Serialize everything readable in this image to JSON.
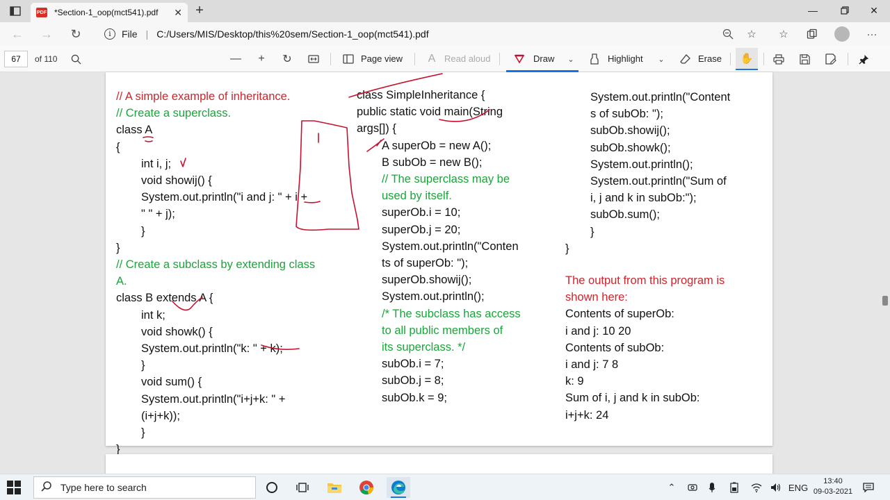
{
  "tab": {
    "title": "*Section-1_oop(mct541).pdf",
    "badge": "PDF"
  },
  "address": {
    "file_label": "File",
    "url": "C:/Users/MIS/Desktop/this%20sem/Section-1_oop(mct541).pdf"
  },
  "pdf_toolbar": {
    "page_current": "67",
    "page_total": "of 110",
    "page_view_label": "Page view",
    "read_aloud_label": "Read aloud",
    "draw_label": "Draw",
    "highlight_label": "Highlight",
    "erase_label": "Erase"
  },
  "document": {
    "col1": [
      {
        "text": "// A simple example of inheritance.",
        "color": "red",
        "indent": 0
      },
      {
        "text": "// Create a superclass.",
        "color": "green",
        "indent": 0
      },
      {
        "text": "class A",
        "color": "black",
        "indent": 0
      },
      {
        "text": "{",
        "color": "black",
        "indent": 0
      },
      {
        "text": "int i, j;",
        "color": "black",
        "indent": 1
      },
      {
        "text": "void showij() {",
        "color": "black",
        "indent": 1
      },
      {
        "text": "System.out.println(\"i and j: \" + i +",
        "color": "black",
        "indent": 1
      },
      {
        "text": "\" \" + j);",
        "color": "black",
        "indent": 1
      },
      {
        "text": "}",
        "color": "black",
        "indent": 1
      },
      {
        "text": "}",
        "color": "black",
        "indent": 0
      },
      {
        "text": "// Create a subclass by extending class",
        "color": "green",
        "indent": 0
      },
      {
        "text": "A.",
        "color": "green",
        "indent": 0
      },
      {
        "text": "class B extends A {",
        "color": "black",
        "indent": 0
      },
      {
        "text": "int k;",
        "color": "black",
        "indent": 1
      },
      {
        "text": "void showk() {",
        "color": "black",
        "indent": 1
      },
      {
        "text": "System.out.println(\"k: \" + k);",
        "color": "black",
        "indent": 1
      },
      {
        "text": "}",
        "color": "black",
        "indent": 1
      },
      {
        "text": "void sum() {",
        "color": "black",
        "indent": 1
      },
      {
        "text": "System.out.println(\"i+j+k: \" +",
        "color": "black",
        "indent": 1
      },
      {
        "text": "(i+j+k));",
        "color": "black",
        "indent": 1
      },
      {
        "text": "}",
        "color": "black",
        "indent": 1
      },
      {
        "text": "}",
        "color": "black",
        "indent": 0
      }
    ],
    "col2": [
      {
        "text": "class SimpleInheritance {",
        "color": "black",
        "indent": 0
      },
      {
        "text": "public static void main(String",
        "color": "black",
        "indent": 0
      },
      {
        "text": "args[]) {",
        "color": "black",
        "indent": 0
      },
      {
        "text": "A superOb = new A();",
        "color": "black",
        "indent": 1
      },
      {
        "text": "B subOb = new B();",
        "color": "black",
        "indent": 1
      },
      {
        "text": "// The superclass may be",
        "color": "green",
        "indent": 1
      },
      {
        "text": "used by itself.",
        "color": "green",
        "indent": 1
      },
      {
        "text": "superOb.i = 10;",
        "color": "black",
        "indent": 1
      },
      {
        "text": "superOb.j = 20;",
        "color": "black",
        "indent": 1
      },
      {
        "text": "System.out.println(\"Conten",
        "color": "black",
        "indent": 1
      },
      {
        "text": "ts of superOb: \");",
        "color": "black",
        "indent": 1
      },
      {
        "text": "superOb.showij();",
        "color": "black",
        "indent": 1
      },
      {
        "text": "System.out.println();",
        "color": "black",
        "indent": 1
      },
      {
        "text": "/* The subclass has access",
        "color": "green",
        "indent": 1
      },
      {
        "text": "to all public members of",
        "color": "green",
        "indent": 1
      },
      {
        "text": "its superclass. */",
        "color": "green",
        "indent": 1
      },
      {
        "text": "subOb.i = 7;",
        "color": "black",
        "indent": 1
      },
      {
        "text": "subOb.j = 8;",
        "color": "black",
        "indent": 1
      },
      {
        "text": "subOb.k = 9;",
        "color": "black",
        "indent": 1
      }
    ],
    "col3a": [
      {
        "text": "System.out.println(\"Content",
        "color": "black",
        "indent": 1
      },
      {
        "text": "s of subOb: \");",
        "color": "black",
        "indent": 1
      },
      {
        "text": "subOb.showij();",
        "color": "black",
        "indent": 1
      },
      {
        "text": "subOb.showk();",
        "color": "black",
        "indent": 1
      },
      {
        "text": "System.out.println();",
        "color": "black",
        "indent": 1
      },
      {
        "text": "System.out.println(\"Sum of",
        "color": "black",
        "indent": 1
      },
      {
        "text": "i, j and k in subOb:\");",
        "color": "black",
        "indent": 1
      },
      {
        "text": "subOb.sum();",
        "color": "black",
        "indent": 1
      },
      {
        "text": "}",
        "color": "black",
        "indent": 1
      },
      {
        "text": "}",
        "color": "black",
        "indent": 0
      }
    ],
    "col3b": [
      {
        "text": "The output from this program is",
        "color": "red",
        "indent": 0
      },
      {
        "text": "shown here:",
        "color": "red",
        "indent": 0
      },
      {
        "text": "Contents of superOb:",
        "color": "black",
        "indent": 0
      },
      {
        "text": "i and j: 10 20",
        "color": "black",
        "indent": 0
      },
      {
        "text": "Contents of subOb:",
        "color": "black",
        "indent": 0
      },
      {
        "text": "i and j: 7 8",
        "color": "black",
        "indent": 0
      },
      {
        "text": "k: 9",
        "color": "black",
        "indent": 0
      },
      {
        "text": "Sum of i, j and k in subOb:",
        "color": "black",
        "indent": 0
      },
      {
        "text": "i+j+k: 24",
        "color": "black",
        "indent": 0
      }
    ]
  },
  "colors": {
    "red": "#d0242b",
    "green": "#1aa53a",
    "black": "#111111",
    "ink": "#c8102e",
    "accent": "#1a73e8"
  },
  "taskbar": {
    "search_placeholder": "Type here to search",
    "language": "ENG",
    "time": "13:40",
    "date": "09-03-2021"
  }
}
